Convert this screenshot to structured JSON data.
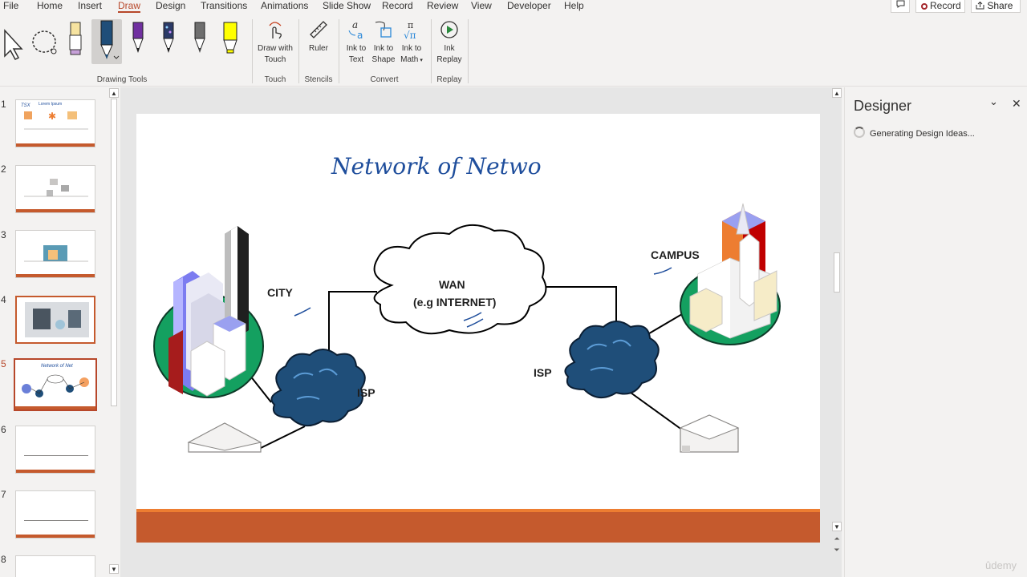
{
  "menu": {
    "items": [
      "File",
      "Home",
      "Insert",
      "Draw",
      "Design",
      "Transitions",
      "Animations",
      "Slide Show",
      "Record",
      "Review",
      "View",
      "Developer",
      "Help"
    ],
    "active": "Draw",
    "record_label": "Record",
    "share_label": "Share"
  },
  "ribbon": {
    "groups": {
      "drawing_tools": "Drawing Tools",
      "touch": "Touch",
      "stencils": "Stencils",
      "convert": "Convert",
      "replay": "Replay"
    },
    "buttons": {
      "draw_with_touch_1": "Draw with",
      "draw_with_touch_2": "Touch",
      "ruler": "Ruler",
      "ink_to_text_1": "Ink to",
      "ink_to_text_2": "Text",
      "ink_to_shape_1": "Ink to",
      "ink_to_shape_2": "Shape",
      "ink_to_math_1": "Ink to",
      "ink_to_math_2": "Math",
      "ink_replay_1": "Ink",
      "ink_replay_2": "Replay"
    },
    "pen_colors": [
      "#f6e3a0",
      "#1f4e79",
      "#7030a0",
      "#1f1f1f",
      "#444444",
      "#ffff00"
    ]
  },
  "thumbnails": {
    "numbers": [
      "1",
      "2",
      "3",
      "4",
      "5",
      "6",
      "7",
      "8"
    ],
    "active": "5"
  },
  "slide": {
    "handwriting_title": "Network of Netwo",
    "labels": {
      "city": "CITY",
      "wan_1": "WAN",
      "wan_2": "(e.g INTERNET)",
      "isp_left": "ISP",
      "isp_right": "ISP",
      "campus": "CAMPUS"
    },
    "accent_color": "#c55a2d",
    "ink_color": "#1f4e9c"
  },
  "designer": {
    "title": "Designer",
    "status": "Generating Design Ideas..."
  },
  "watermark": "ûdemy"
}
